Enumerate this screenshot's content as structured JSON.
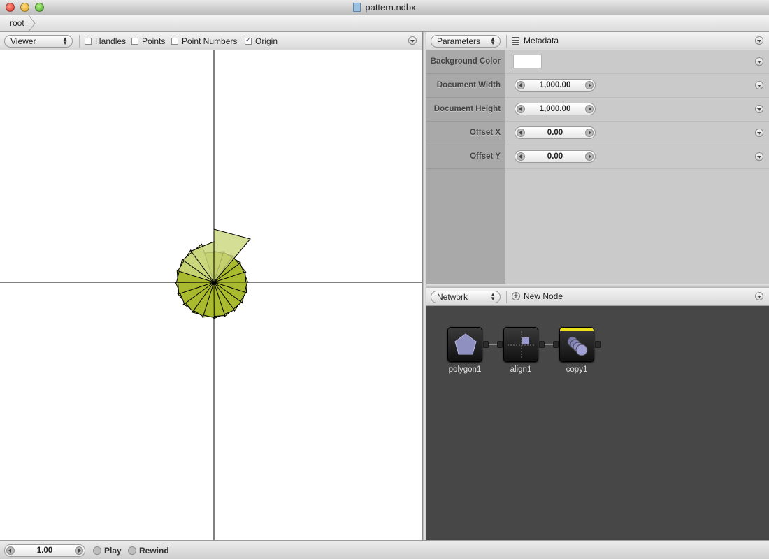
{
  "window": {
    "title": "pattern.ndbx"
  },
  "breadcrumb": {
    "root": "root"
  },
  "viewer": {
    "mode": "Viewer",
    "options": [
      {
        "label": "Handles",
        "checked": false
      },
      {
        "label": "Points",
        "checked": false
      },
      {
        "label": "Point Numbers",
        "checked": false
      },
      {
        "label": "Origin",
        "checked": true
      }
    ],
    "shape_fill": "#a8b829",
    "shape_fill_light": "#c9d67a"
  },
  "params_panel": {
    "mode": "Parameters",
    "metadata_label": "Metadata",
    "rows": [
      {
        "label": "Background Color",
        "type": "color",
        "value": "#ffffff"
      },
      {
        "label": "Document Width",
        "type": "number",
        "value": "1,000.00"
      },
      {
        "label": "Document Height",
        "type": "number",
        "value": "1,000.00"
      },
      {
        "label": "Offset X",
        "type": "number",
        "value": "0.00"
      },
      {
        "label": "Offset Y",
        "type": "number",
        "value": "0.00"
      }
    ]
  },
  "network_panel": {
    "mode": "Network",
    "new_node_label": "New Node",
    "nodes": [
      {
        "name": "polygon1",
        "icon": "pentagon-icon",
        "rendered": false
      },
      {
        "name": "align1",
        "icon": "align-icon",
        "rendered": false
      },
      {
        "name": "copy1",
        "icon": "copy-icon",
        "rendered": true
      }
    ],
    "rendered_color": "#e8e21a"
  },
  "playback": {
    "frame": "1.00",
    "play_label": "Play",
    "rewind_label": "Rewind"
  }
}
